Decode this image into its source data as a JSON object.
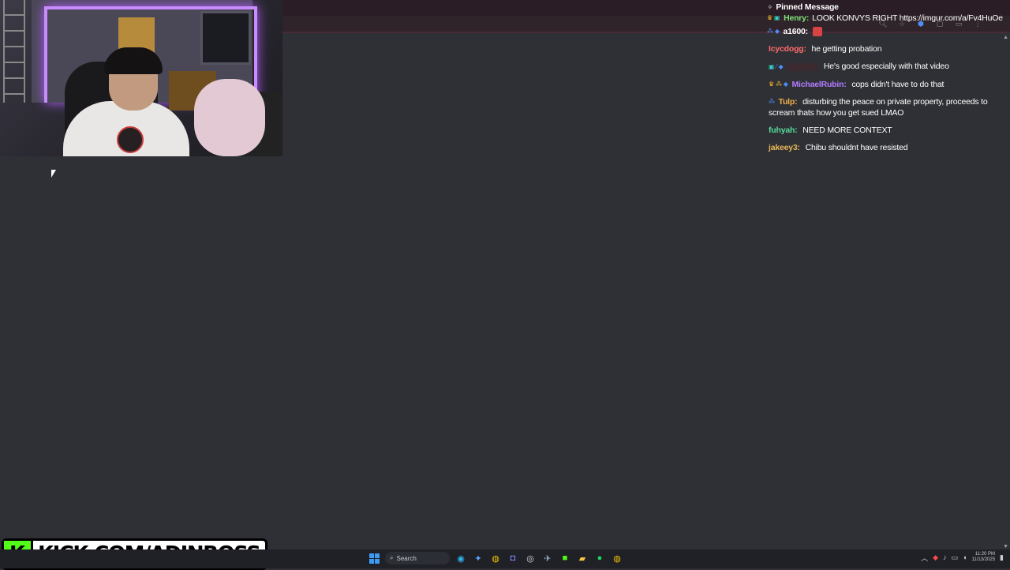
{
  "browser": {
    "toolbar_icons": [
      "search-icon",
      "star-icon",
      "extension-icon",
      "profile-icon",
      "sidebar-icon",
      "menu-icon"
    ]
  },
  "chat": {
    "pinned": {
      "title": "Pinned Message",
      "author": "Henry:",
      "text": "LOOK KONVYS RIGHT https://imgur.com/a/Fv4HuOe"
    },
    "pinned_reply": {
      "author": "a1600:"
    },
    "messages": [
      {
        "author": "Icycdogg:",
        "text": "he getting probation"
      },
      {
        "author": "",
        "text": "He's good especially with that video"
      },
      {
        "author": "MichaelRubin:",
        "text": "cops didn't have to do that"
      },
      {
        "author": "Tulp:",
        "text": "disturbing the peace on private property, proceeds to scream thats how you get sued LMAO"
      },
      {
        "author": "fuhyah:",
        "text": "NEED MORE CONTEXT"
      },
      {
        "author": "jakeey3:",
        "text": "Chibu shouldnt have resisted"
      }
    ]
  },
  "overlay": {
    "kick_logo": "K",
    "kick_url": "KICK.COM/ADINROSS"
  },
  "taskbar": {
    "search_label": "Search",
    "time": "11:20 PM",
    "date": "11/13/2025"
  },
  "colors": {
    "kick_green": "#53fc18",
    "chat_bg": "#2e3035",
    "led_purple": "#c98cff"
  }
}
